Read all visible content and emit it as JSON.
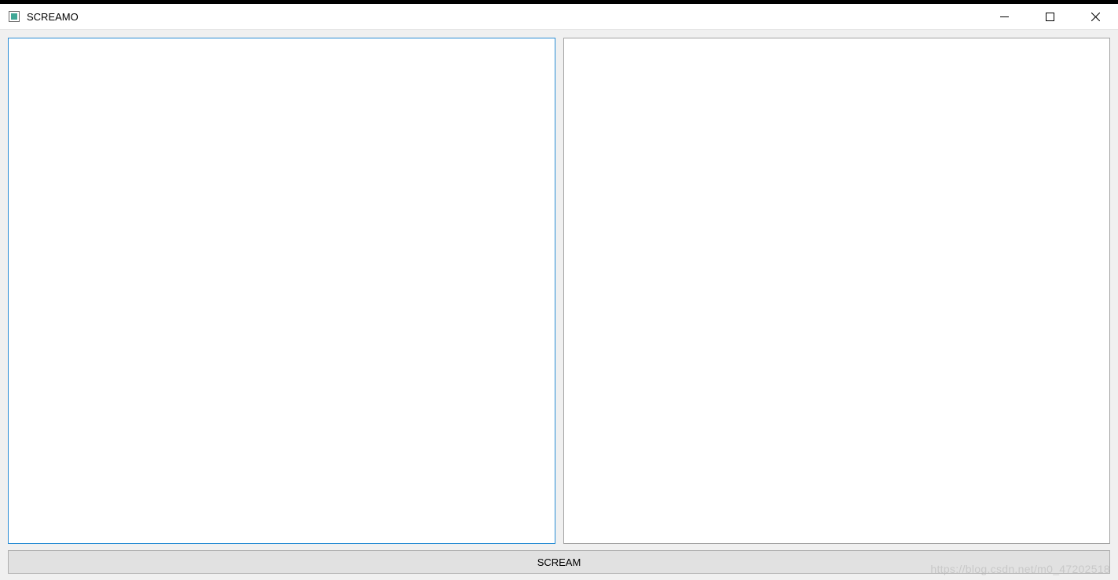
{
  "window": {
    "title": "SCREAMO"
  },
  "panes": {
    "left_value": "",
    "right_value": ""
  },
  "button": {
    "scream_label": "SCREAM"
  },
  "watermark": "https://blog.csdn.net/m0_47202518"
}
